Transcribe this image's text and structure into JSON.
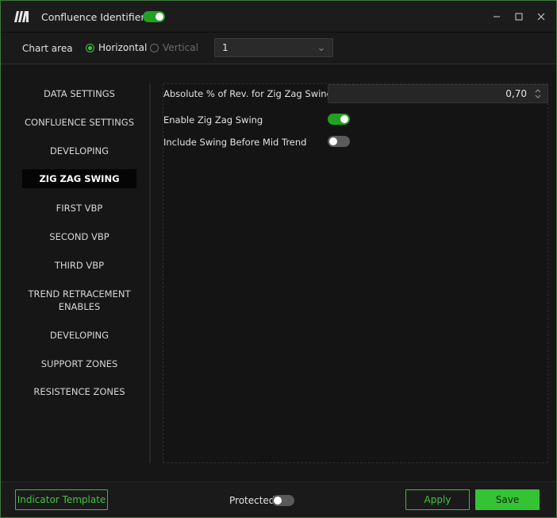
{
  "titlebar": {
    "title": "Confluence Identifier",
    "indicator_enabled": true
  },
  "toolbar": {
    "chart_area_label": "Chart area",
    "orientation_options": [
      {
        "label": "Horizontal",
        "selected": true
      },
      {
        "label": "Vertical",
        "selected": false
      }
    ],
    "pane_select_value": "1"
  },
  "sidebar": {
    "items": [
      {
        "label": "DATA SETTINGS",
        "active": false
      },
      {
        "label": "CONFLUENCE SETTINGS",
        "active": false
      },
      {
        "label": "DEVELOPING",
        "active": false
      },
      {
        "label": "ZIG ZAG SWING",
        "active": true
      },
      {
        "label": "FIRST VBP",
        "active": false
      },
      {
        "label": "SECOND VBP",
        "active": false
      },
      {
        "label": "THIRD VBP",
        "active": false
      },
      {
        "label": "TREND RETRACEMENT",
        "label2": "ENABLES",
        "active": false
      },
      {
        "label": "DEVELOPING",
        "active": false
      },
      {
        "label": "SUPPORT ZONES",
        "active": false
      },
      {
        "label": "RESISTENCE ZONES",
        "active": false
      }
    ]
  },
  "settings": {
    "abs_rev_label": "Absolute % of Rev. for Zig Zag Swing",
    "abs_rev_value": "0,70",
    "enable_zigzag_label": "Enable Zig Zag Swing",
    "enable_zigzag_on": true,
    "include_swing_label": "Include Swing Before Mid Trend",
    "include_swing_on": false
  },
  "footer": {
    "template_button": "Indicator Template",
    "protected_label": "Protected",
    "protected_on": false,
    "apply_button": "Apply",
    "save_button": "Save"
  },
  "colors": {
    "accent": "#3ec63e",
    "background": "#161616",
    "active_item_bg": "#050505"
  },
  "icons": [
    "app-logo-icon",
    "minimize-icon",
    "maximize-icon",
    "close-icon",
    "chevron-down-icon",
    "spinner-arrows-icon"
  ]
}
